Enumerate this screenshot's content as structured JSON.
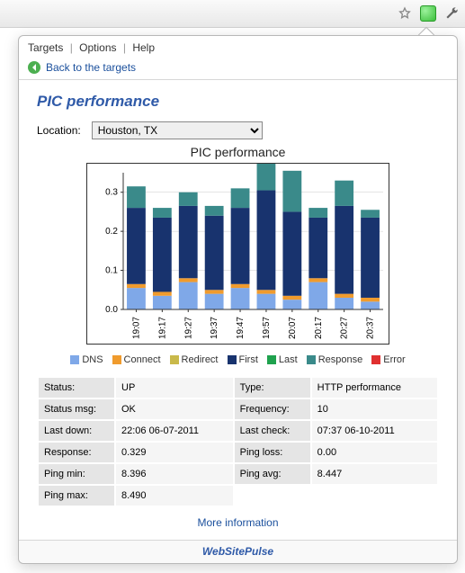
{
  "menu": {
    "targets": "Targets",
    "options": "Options",
    "help": "Help"
  },
  "back_label": "Back to the targets",
  "page_title": "PIC performance",
  "location_label": "Location:",
  "location_value": "Houston, TX",
  "more_info": "More information",
  "footer": "WebSitePulse",
  "chart_data": {
    "type": "bar",
    "title": "PIC performance",
    "ylim": [
      0,
      0.35
    ],
    "yticks": [
      0.0,
      0.1,
      0.2,
      0.3
    ],
    "categories": [
      "19:07",
      "19:17",
      "19:27",
      "19:37",
      "19:47",
      "19:57",
      "20:07",
      "20:17",
      "20:27",
      "20:37"
    ],
    "series": [
      {
        "name": "DNS",
        "color": "#7fa8e8",
        "values": [
          0.055,
          0.035,
          0.07,
          0.04,
          0.055,
          0.04,
          0.025,
          0.07,
          0.03,
          0.02
        ]
      },
      {
        "name": "Connect",
        "color": "#f09b2d",
        "values": [
          0.01,
          0.01,
          0.01,
          0.01,
          0.01,
          0.01,
          0.01,
          0.01,
          0.01,
          0.01
        ]
      },
      {
        "name": "Redirect",
        "color": "#c9b94a",
        "values": [
          0,
          0,
          0,
          0,
          0,
          0,
          0,
          0,
          0,
          0
        ]
      },
      {
        "name": "First",
        "color": "#18336e",
        "values": [
          0.195,
          0.19,
          0.185,
          0.19,
          0.195,
          0.255,
          0.215,
          0.155,
          0.225,
          0.205
        ]
      },
      {
        "name": "Last",
        "color": "#1fa24e",
        "values": [
          0,
          0,
          0,
          0,
          0,
          0,
          0,
          0,
          0,
          0
        ]
      },
      {
        "name": "Response",
        "color": "#3a8a8a",
        "values": [
          0.055,
          0.025,
          0.035,
          0.025,
          0.05,
          0.07,
          0.105,
          0.025,
          0.065,
          0.02
        ]
      },
      {
        "name": "Error",
        "color": "#e03030",
        "values": [
          0,
          0,
          0,
          0,
          0,
          0,
          0,
          0,
          0,
          0
        ]
      }
    ]
  },
  "details": {
    "rows": [
      [
        {
          "label": "Status:",
          "value": "UP"
        },
        {
          "label": "Type:",
          "value": "HTTP performance"
        }
      ],
      [
        {
          "label": "Status msg:",
          "value": "OK"
        },
        {
          "label": "Frequency:",
          "value": "10"
        }
      ],
      [
        {
          "label": "Last down:",
          "value": "22:06 06-07-2011"
        },
        {
          "label": "Last check:",
          "value": "07:37 06-10-2011"
        }
      ],
      [
        {
          "label": "Response:",
          "value": "0.329"
        },
        {
          "label": "Ping loss:",
          "value": "0.00"
        }
      ],
      [
        {
          "label": "Ping min:",
          "value": "8.396"
        },
        {
          "label": "Ping avg:",
          "value": "8.447"
        }
      ],
      [
        {
          "label": "Ping max:",
          "value": "8.490"
        },
        null
      ]
    ]
  }
}
